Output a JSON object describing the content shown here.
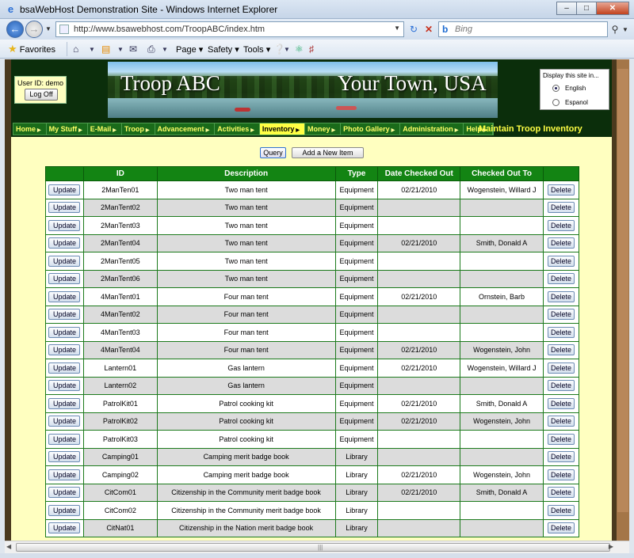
{
  "window": {
    "title": "bsaWebHost Demonstration Site - Windows Internet Explorer",
    "minimize": "–",
    "maximize": "□",
    "close": "✕"
  },
  "addressbar": {
    "url": "http://www.bsawebhost.com/TroopABC/index.htm",
    "search_placeholder": "Bing"
  },
  "commandbar": {
    "favorites": "Favorites",
    "menus": [
      "Page",
      "Safety",
      "Tools"
    ]
  },
  "header": {
    "user_id_label": "User ID: demo",
    "logoff_label": "Log Off",
    "banner_left": "Troop ABC",
    "banner_right": "Your Town, USA",
    "language_heading": "Display this site in...",
    "languages": [
      {
        "label": "English",
        "selected": true
      },
      {
        "label": "Espanol",
        "selected": false
      }
    ]
  },
  "menu": {
    "items": [
      "Home",
      "My Stuff",
      "E-Mail",
      "Troop",
      "Advancement",
      "Activities",
      "Inventory",
      "Money",
      "Photo Gallery",
      "Administration",
      "Help"
    ],
    "active": "Inventory",
    "page_title": "Maintain Troop Inventory"
  },
  "actions": {
    "query_label": "Query",
    "add_label": "Add a New Item"
  },
  "table": {
    "columns": [
      "",
      "ID",
      "Description",
      "Type",
      "Date Checked Out",
      "Checked Out To",
      ""
    ],
    "update_label": "Update",
    "delete_label": "Delete",
    "rows": [
      {
        "id": "2ManTen01",
        "description": "Two man tent",
        "type": "Equipment",
        "date": "02/21/2010",
        "to": "Wogenstein, Willard J"
      },
      {
        "id": "2ManTent02",
        "description": "Two man tent",
        "type": "Equipment",
        "date": "",
        "to": ""
      },
      {
        "id": "2ManTent03",
        "description": "Two man tent",
        "type": "Equipment",
        "date": "",
        "to": ""
      },
      {
        "id": "2ManTent04",
        "description": "Two man tent",
        "type": "Equipment",
        "date": "02/21/2010",
        "to": "Smith, Donald A"
      },
      {
        "id": "2ManTent05",
        "description": "Two man tent",
        "type": "Equipment",
        "date": "",
        "to": ""
      },
      {
        "id": "2ManTent06",
        "description": "Two man tent",
        "type": "Equipment",
        "date": "",
        "to": ""
      },
      {
        "id": "4ManTent01",
        "description": "Four man tent",
        "type": "Equipment",
        "date": "02/21/2010",
        "to": "Ornstein, Barb"
      },
      {
        "id": "4ManTent02",
        "description": "Four man tent",
        "type": "Equipment",
        "date": "",
        "to": ""
      },
      {
        "id": "4ManTent03",
        "description": "Four man tent",
        "type": "Equipment",
        "date": "",
        "to": ""
      },
      {
        "id": "4ManTent04",
        "description": "Four man tent",
        "type": "Equipment",
        "date": "02/21/2010",
        "to": "Wogenstein, John"
      },
      {
        "id": "Lantern01",
        "description": "Gas lantern",
        "type": "Equipment",
        "date": "02/21/2010",
        "to": "Wogenstein, Willard J"
      },
      {
        "id": "Lantern02",
        "description": "Gas lantern",
        "type": "Equipment",
        "date": "",
        "to": ""
      },
      {
        "id": "PatrolKit01",
        "description": "Patrol cooking kit",
        "type": "Equipment",
        "date": "02/21/2010",
        "to": "Smith, Donald A"
      },
      {
        "id": "PatrolKit02",
        "description": "Patrol cooking kit",
        "type": "Equipment",
        "date": "02/21/2010",
        "to": "Wogenstein, John"
      },
      {
        "id": "PatrolKit03",
        "description": "Patrol cooking kit",
        "type": "Equipment",
        "date": "",
        "to": ""
      },
      {
        "id": "Camping01",
        "description": "Camping merit badge book",
        "type": "Library",
        "date": "",
        "to": ""
      },
      {
        "id": "Camping02",
        "description": "Camping merit badge book",
        "type": "Library",
        "date": "02/21/2010",
        "to": "Wogenstein, John"
      },
      {
        "id": "CitCom01",
        "description": "Citizenship in the Community merit badge book",
        "type": "Library",
        "date": "02/21/2010",
        "to": "Smith, Donald A"
      },
      {
        "id": "CitCom02",
        "description": "Citizenship in the Community merit badge book",
        "type": "Library",
        "date": "",
        "to": ""
      },
      {
        "id": "CitNat01",
        "description": "Citizenship in the Nation merit badge book",
        "type": "Library",
        "date": "",
        "to": ""
      }
    ]
  },
  "colors": {
    "page_bg": "#ffffc0",
    "header_bg": "#0b2e0b",
    "table_header": "#138413",
    "menu_text": "#ffff66"
  }
}
